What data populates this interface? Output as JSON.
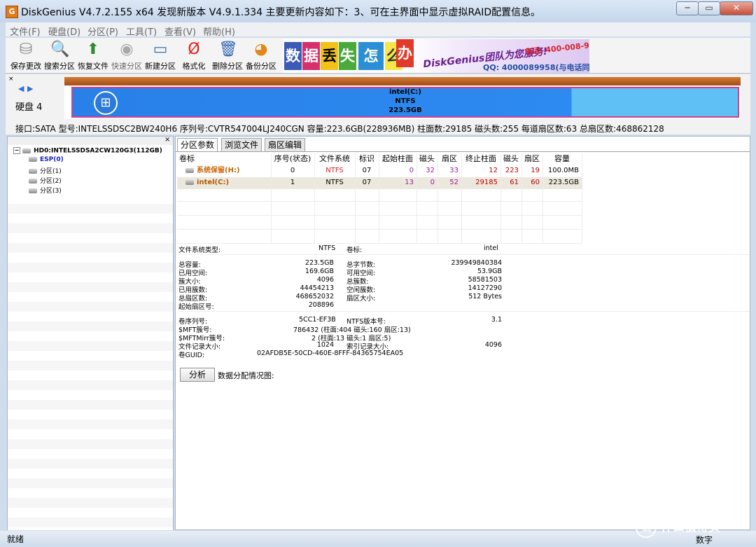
{
  "window": {
    "title": "DiskGenius V4.7.2.155 x64    发现新版本 V4.9.1.334 主要更新内容如下：3、可在主界面中显示虚拟RAID配置信息。",
    "app_icon": "G"
  },
  "menu": [
    "文件(F)",
    "硬盘(D)",
    "分区(P)",
    "工具(T)",
    "查看(V)",
    "帮助(H)"
  ],
  "toolbar": [
    {
      "label": "保存更改",
      "icon": "save-icon"
    },
    {
      "label": "搜索分区",
      "icon": "magnifier-icon"
    },
    {
      "label": "恢复文件",
      "icon": "recover-box-icon"
    },
    {
      "label": "快速分区",
      "icon": "quick-partition-icon"
    },
    {
      "label": "新建分区",
      "icon": "new-partition-icon"
    },
    {
      "label": "格式化",
      "icon": "format-icon"
    },
    {
      "label": "删除分区",
      "icon": "delete-icon"
    },
    {
      "label": "备份分区",
      "icon": "backup-icon"
    }
  ],
  "banner": {
    "tiles": [
      "数",
      "据",
      "丢",
      "失",
      "怎",
      "么",
      "办"
    ],
    "brand": "DiskGenius团队为您服务!",
    "phone": "电话: 400-008-9958",
    "qq": "QQ: 4000089958(与电话同号)"
  },
  "disk": {
    "label": "硬盘 4",
    "partition_line1": "intel(C:)",
    "partition_line2": "NTFS",
    "partition_line3": "223.5GB",
    "info": "接口:SATA  型号:INTELSSDSC2BW240H6  序列号:CVTR547004LJ240CGN  容量:223.6GB(228936MB)  柱面数:29185  磁头数:255  每道扇区数:63  总扇区数:468862128"
  },
  "tree": {
    "root": "HD0:INTELSSDSA2CW120G3(112GB)",
    "children": [
      "ESP(0)",
      "分区(1)",
      "分区(2)",
      "分区(3)"
    ]
  },
  "tabs": [
    "分区参数",
    "浏览文件",
    "扇区编辑"
  ],
  "table": {
    "headers": [
      "卷标",
      "序号(状态)",
      "文件系统",
      "标识",
      "起始柱面",
      "磁头",
      "扇区",
      "终止柱面",
      "磁头",
      "扇区",
      "容量"
    ],
    "rows": [
      [
        "系统保留(H:)",
        "0",
        "NTFS",
        "07",
        "0",
        "32",
        "33",
        "12",
        "223",
        "19",
        "100.0MB"
      ],
      [
        "intel(C:)",
        "1",
        "NTFS",
        "07",
        "13",
        "0",
        "52",
        "29185",
        "61",
        "60",
        "223.5GB"
      ]
    ]
  },
  "details": {
    "fs_type_label": "文件系统类型:",
    "fs_type": "NTFS",
    "vol_label_label": "卷标:",
    "vol_label": "intel",
    "left": [
      [
        "总容量:",
        "223.5GB"
      ],
      [
        "已用空间:",
        "169.6GB"
      ],
      [
        "簇大小:",
        "4096"
      ],
      [
        "已用簇数:",
        "44454213"
      ],
      [
        "总扇区数:",
        "468652032"
      ],
      [
        "起始扇区号:",
        "208896"
      ]
    ],
    "right": [
      [
        "总字节数:",
        "239949840384"
      ],
      [
        "可用空间:",
        "53.9GB"
      ],
      [
        "总簇数:",
        "58581503"
      ],
      [
        "空闲簇数:",
        "14127290"
      ],
      [
        "扇区大小:",
        "512 Bytes"
      ]
    ],
    "serial_label": "卷序列号:",
    "serial": "5CC1-EF3B",
    "ntfs_ver_label": "NTFS版本号:",
    "ntfs_ver": "3.1",
    "mft_label": "$MFT簇号:",
    "mft": "786432 (柱面:404 磁头:160 扇区:13)",
    "mftmirr_label": "$MFTMirr簇号:",
    "mftmirr": "2 (柱面:13 磁头:1 扇区:5)",
    "record_label": "文件记录大小:",
    "record": "1024",
    "index_label": "索引记录大小:",
    "index": "4096",
    "guid_label": "卷GUID:",
    "guid": "02AFDB5E-50CD-460E-8FFF-84365754EA05"
  },
  "analyze_button": "分析",
  "alloc_label": "数据分配情况图:",
  "status": {
    "text": "就绪",
    "numlock": "数字"
  },
  "watermark": {
    "icon": "值",
    "text": "什么值得买"
  }
}
